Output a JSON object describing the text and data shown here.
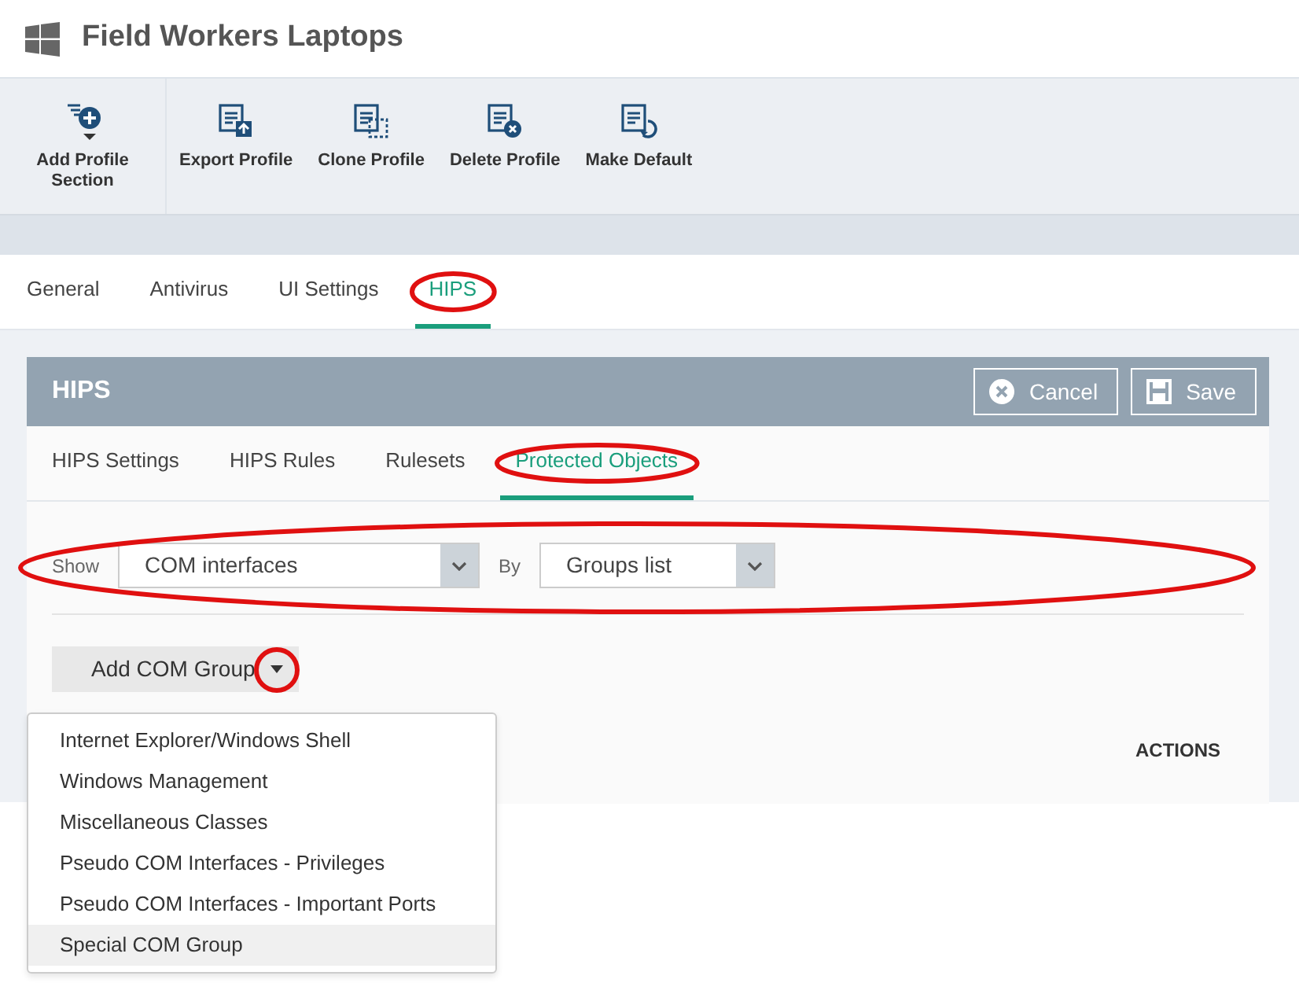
{
  "header": {
    "title": "Field Workers Laptops"
  },
  "toolbar": [
    {
      "label": "Add Profile Section",
      "kind": "add"
    },
    {
      "label": "Export Profile",
      "kind": "export"
    },
    {
      "label": "Clone Profile",
      "kind": "clone"
    },
    {
      "label": "Delete Profile",
      "kind": "delete"
    },
    {
      "label": "Make Default",
      "kind": "default"
    }
  ],
  "tabs": [
    {
      "label": "General",
      "selected": false,
      "circled": false
    },
    {
      "label": "Antivirus",
      "selected": false,
      "circled": false
    },
    {
      "label": "UI Settings",
      "selected": false,
      "circled": false
    },
    {
      "label": "HIPS",
      "selected": true,
      "circled": true
    }
  ],
  "panel": {
    "title": "HIPS",
    "buttons": [
      {
        "label": "Cancel",
        "kind": "cancel"
      },
      {
        "label": "Save",
        "kind": "save"
      }
    ],
    "tabs": [
      {
        "label": "HIPS Settings",
        "selected": false,
        "circled": false
      },
      {
        "label": "HIPS Rules",
        "selected": false,
        "circled": false
      },
      {
        "label": "Rulesets",
        "selected": false,
        "circled": false
      },
      {
        "label": "Protected Objects",
        "selected": true,
        "circled": true
      }
    ],
    "filter": {
      "circled": true,
      "show_label": "Show",
      "show_value": "COM interfaces",
      "by_label": "By",
      "by_value": "Groups list"
    },
    "add_button": {
      "label": "Add COM Group",
      "caret_circled": true
    },
    "table": {
      "columns": [
        "ACTIONS"
      ]
    },
    "menu": [
      {
        "label": "Internet Explorer/Windows Shell",
        "selected": false
      },
      {
        "label": "Windows Management",
        "selected": false
      },
      {
        "label": "Miscellaneous Classes",
        "selected": false
      },
      {
        "label": "Pseudo COM Interfaces - Privileges",
        "selected": false
      },
      {
        "label": "Pseudo COM Interfaces - Important Ports",
        "selected": false
      },
      {
        "label": "Special COM Group",
        "selected": true
      }
    ]
  }
}
